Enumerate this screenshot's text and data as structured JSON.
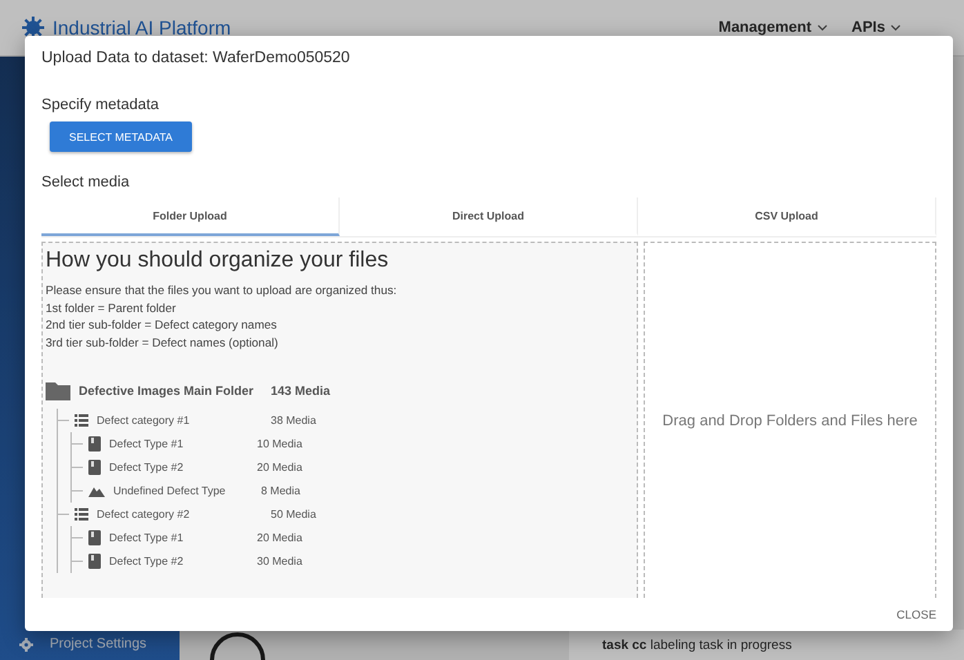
{
  "header": {
    "app_title": "Industrial AI Platform",
    "menus": [
      {
        "label": "Management"
      },
      {
        "label": "APIs"
      }
    ]
  },
  "sidebar": {
    "footer_item": "Project Settings"
  },
  "activity": {
    "message": "**task cc** labeling task in progress"
  },
  "dialog": {
    "title": "Upload Data to dataset: WaferDemo050520",
    "metadata_label": "Specify metadata",
    "metadata_button": "SELECT METADATA",
    "media_label": "Select media",
    "tabs": [
      {
        "label": "Folder Upload",
        "selected": true
      },
      {
        "label": "Direct Upload",
        "selected": false
      },
      {
        "label": "CSV Upload",
        "selected": false
      }
    ],
    "guide": {
      "heading": "How you should organize your files",
      "lines": [
        "Please ensure that the files you want to upload are organized thus:",
        "1st folder = Parent folder",
        "2nd tier sub-folder = Defect category names",
        "3rd tier sub-folder = Defect names (optional)"
      ],
      "tree": [
        {
          "kind": "folder",
          "name": "Defective Images Main Folder",
          "count": "143 Media",
          "children": [
            {
              "kind": "category",
              "name": "Defect category #1",
              "count": "38 Media",
              "children": [
                {
                  "kind": "type",
                  "name": "Defect Type #1",
                  "count": "10 Media"
                },
                {
                  "kind": "type",
                  "name": "Defect Type #2",
                  "count": "20 Media"
                },
                {
                  "kind": "undefined",
                  "name": "Undefined Defect Type",
                  "count": "8 Media"
                }
              ]
            },
            {
              "kind": "category",
              "name": "Defect category #2",
              "count": "50 Media",
              "children": [
                {
                  "kind": "type",
                  "name": "Defect Type #1",
                  "count": "20 Media"
                },
                {
                  "kind": "type",
                  "name": "Defect Type #2",
                  "count": "30 Media"
                }
              ]
            }
          ]
        }
      ]
    },
    "dropzone": "Drag and Drop Folders and Files here",
    "close_button": "CLOSE"
  }
}
